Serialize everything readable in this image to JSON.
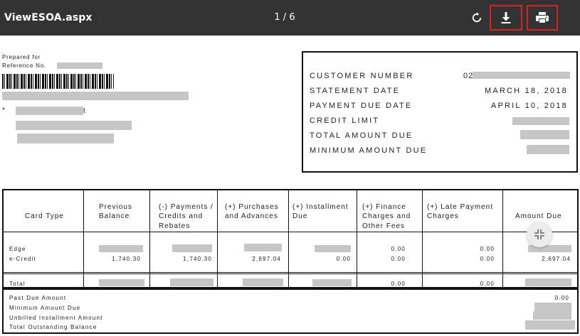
{
  "toolbar": {
    "filename": "ViewESOA.aspx",
    "page_indicator": "1 / 6",
    "icons": [
      "rotate-icon",
      "download-icon",
      "print-icon"
    ]
  },
  "header": {
    "prepared_for": "Prepared for",
    "reference_no": "Reference No.",
    "address_bullet": "*",
    "address_fragment": "t"
  },
  "customer": {
    "number_label": "CUSTOMER NUMBER",
    "number_prefix": "02",
    "statement_date_label": "STATEMENT DATE",
    "statement_date": "MARCH 18, 2018",
    "payment_due_label": "PAYMENT DUE DATE",
    "payment_due": "APRIL 10, 2018",
    "credit_limit_label": "CREDIT LIMIT",
    "total_due_label": "TOTAL AMOUNT DUE",
    "minimum_due_label": "MINIMUM AMOUNT DUE"
  },
  "table": {
    "headers": {
      "card_type": "Card Type",
      "previous_balance": [
        "Previous",
        "Balance"
      ],
      "payments": [
        "(-) Payments /",
        "Credits and",
        "Rebates"
      ],
      "purchases": [
        "(+) Purchases",
        "and Advances"
      ],
      "installment": [
        "(+) Installment",
        "Due"
      ],
      "finance": [
        "(+) Finance",
        "Charges and",
        "Other Fees"
      ],
      "late_payment": [
        "(+) Late Payment",
        "Charges"
      ],
      "amount_due": "Amount Due"
    },
    "rows": {
      "card_name": "Edge",
      "card_sub": "e-Credit",
      "previous_balance": "1,740.30",
      "payments": "1,740.30",
      "purchases": "2,697.04",
      "installment": "0.00",
      "finance_1": "0.00",
      "finance_2": "0.00",
      "late_1": "0.00",
      "late_2": "0.00",
      "amount_due": "2,697.04"
    },
    "total": {
      "label": "Total",
      "finance": "0.00",
      "late": "0.00"
    }
  },
  "summary": {
    "past_due_label": "Past Due Amount",
    "past_due_value": "0.00",
    "minimum_label": "Minimum Amount Due",
    "unbilled_label": "Unbilled Installment Amount",
    "outstanding_label": "Total Outstanding Balance"
  }
}
